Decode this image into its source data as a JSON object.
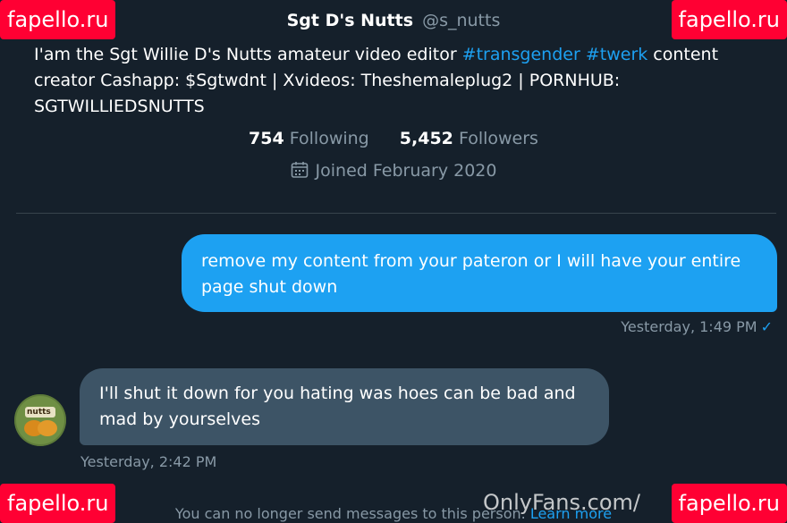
{
  "profile": {
    "display_name": "Sgt D's Nutts",
    "handle": "@s_nutts",
    "bio_text_1": "I'am the Sgt Willie D's Nutts amateur video editor ",
    "bio_hashtag_1": "#transgender",
    "bio_hashtag_2": "#twerk",
    "bio_text_2": " content creator Cashapp: $Sgtwdnt | Xvideos: Theshemaleplug2 | PORNHUB: SGTWILLIEDSNUTTS",
    "following_count": "754",
    "following_label": "Following",
    "followers_count": "5,452",
    "followers_label": "Followers",
    "joined": "Joined February 2020"
  },
  "messages": [
    {
      "direction": "outgoing",
      "text": "remove my content from your pateron or I will have your entire page shut down",
      "timestamp": "Yesterday, 1:49 PM",
      "status_icon": "checkmark-icon",
      "status_glyph": "✓"
    },
    {
      "direction": "incoming",
      "text": "I'll shut it down for you hating was hoes can be bad and mad by yourselves",
      "timestamp": "Yesterday, 2:42 PM",
      "avatar_text": "nutts"
    }
  ],
  "footer": {
    "notice": "You can no longer send messages to this person.",
    "learn_more": "Learn more"
  },
  "watermarks": {
    "fapello": "fapello.ru",
    "onlyfans": "OnlyFans.com/"
  },
  "colors": {
    "background": "#15202b",
    "accent": "#1da1f2",
    "incoming_bubble": "#3d5466",
    "muted_text": "#8899a6",
    "watermark_bg": "#ff0033"
  }
}
